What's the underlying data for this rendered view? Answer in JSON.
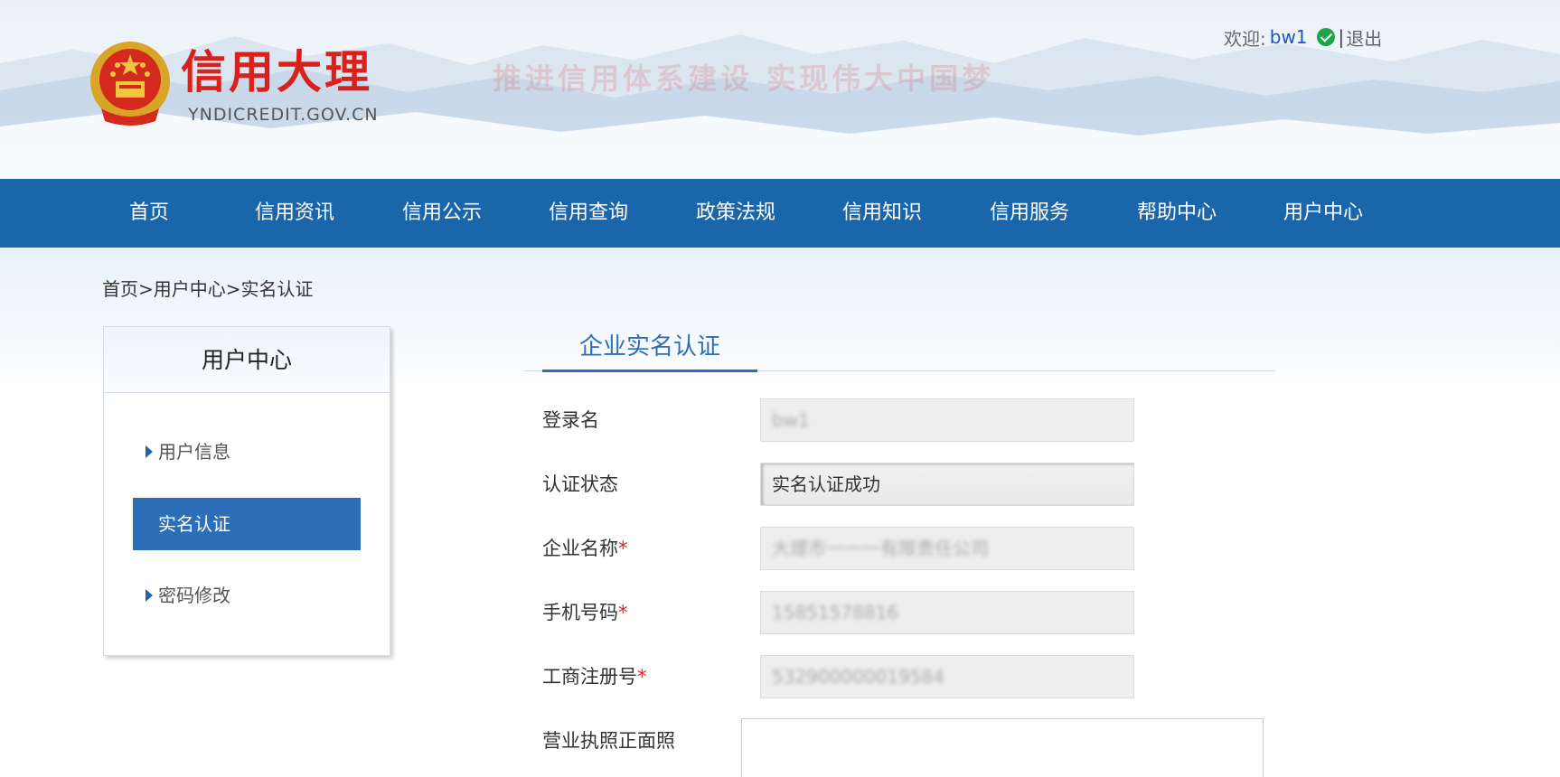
{
  "header": {
    "brand_title": "信用大理",
    "brand_domain": "YNDICREDIT.GOV.CN",
    "slogan": "推进信用体系建设 实现伟大中国梦",
    "welcome_label": "欢迎:",
    "username": "bw1",
    "separator": "|",
    "logout_label": "退出"
  },
  "nav": {
    "items": [
      {
        "label": "首页"
      },
      {
        "label": "信用资讯"
      },
      {
        "label": "信用公示"
      },
      {
        "label": "信用查询"
      },
      {
        "label": "政策法规"
      },
      {
        "label": "信用知识"
      },
      {
        "label": "信用服务"
      },
      {
        "label": "帮助中心"
      },
      {
        "label": "用户中心"
      }
    ]
  },
  "breadcrumb": "首页>用户中心>实名认证",
  "sidebar": {
    "title": "用户中心",
    "items": [
      {
        "label": "用户信息",
        "active": false
      },
      {
        "label": "实名认证",
        "active": true
      },
      {
        "label": "密码修改",
        "active": false
      }
    ]
  },
  "main": {
    "tab_label": "企业实名认证",
    "fields": [
      {
        "label": "登录名",
        "required": false,
        "value": "bw1",
        "obscured": true
      },
      {
        "label": "认证状态",
        "required": false,
        "value": "实名认证成功",
        "obscured": false
      },
      {
        "label": "企业名称",
        "required": true,
        "value": "大理市一一一有限责任公司",
        "obscured": true
      },
      {
        "label": "手机号码",
        "required": true,
        "value": "15851578816",
        "obscured": true
      },
      {
        "label": "工商注册号",
        "required": true,
        "value": "532900000019584",
        "obscured": true
      }
    ],
    "required_mark": "*",
    "upload_label": "营业执照正面照"
  },
  "colors": {
    "nav_bg": "#1b66aa",
    "accent": "#2c6fb8",
    "brand_red": "#d9211c",
    "verified_green": "#1ea446"
  }
}
